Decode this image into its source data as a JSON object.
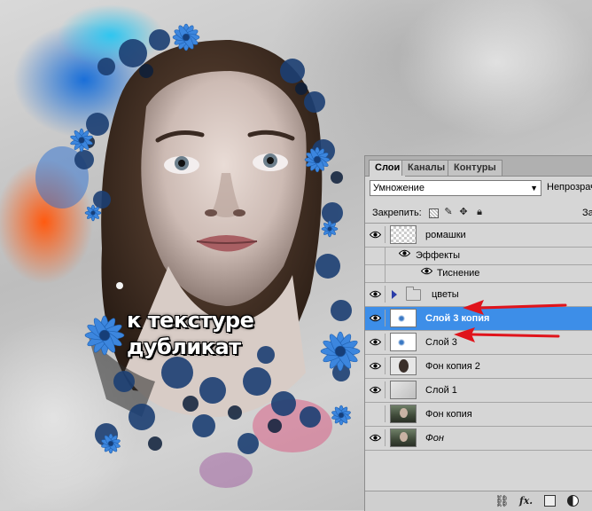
{
  "canvas": {
    "overlay_text_line1": "к текстуре",
    "overlay_text_line2": "дубликат"
  },
  "panel": {
    "tabs": [
      {
        "label": "Слои",
        "active": true
      },
      {
        "label": "Каналы",
        "active": false
      },
      {
        "label": "Контуры",
        "active": false
      }
    ],
    "blend_mode": "Умножение",
    "opacity_label": "Непрозрачн",
    "lock_label": "Закрепить:",
    "fill_label": "Зал",
    "layers": [
      {
        "name": "ромашки",
        "visible": true,
        "thumb": "transparent"
      },
      {
        "name": "Эффекты",
        "visible": true,
        "type": "effects"
      },
      {
        "name": "Тиснение",
        "visible": true,
        "type": "effect"
      },
      {
        "name": "цветы",
        "visible": true,
        "type": "group"
      },
      {
        "name": "Слой 3 копия",
        "visible": true,
        "selected": true,
        "thumb": "flower"
      },
      {
        "name": "Слой 3",
        "visible": true,
        "thumb": "flower"
      },
      {
        "name": "Фон копия 2",
        "visible": true,
        "thumb": "face"
      },
      {
        "name": "Слой 1",
        "visible": true,
        "thumb": "gray"
      },
      {
        "name": "Фон копия",
        "visible": false,
        "thumb": "photo"
      },
      {
        "name": "Фон",
        "visible": true,
        "thumb": "photo",
        "italic": true
      }
    ],
    "footer": {
      "link_icon": "link-icon",
      "fx_label": "fx.",
      "mask_icon": "layer-mask-icon",
      "adjustment_icon": "adjustment-layer-icon"
    },
    "selection_color": "#3d8ee8"
  },
  "annotations": {
    "arrow_color": "#e0141b"
  }
}
